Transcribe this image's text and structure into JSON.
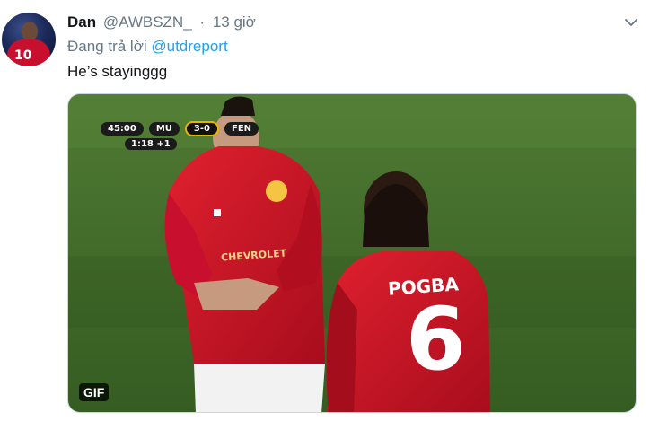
{
  "tweet": {
    "author_name": "Dan",
    "author_handle": "@AWBSZN_",
    "separator": "·",
    "time": "13 giờ",
    "reply_prefix": "Đang trả lời",
    "reply_mention": "@utdreport",
    "text": "He’s stayinggg",
    "avatar_number": "10"
  },
  "media": {
    "badge": "GIF",
    "scoreboard": {
      "time": "45:00",
      "home": "MU",
      "score": "3-0",
      "away": "FEN",
      "added_time": "1:18 +1"
    },
    "jersey_name": "POGBA",
    "jersey_number": "6",
    "sponsor": "CHEVROLET"
  },
  "icons": {
    "caret": "chevron-down-icon"
  },
  "colors": {
    "text": "#14171a",
    "muted": "#657786",
    "link": "#1da1f2",
    "jersey_red": "#c8102e",
    "pitch_green": "#3f6b2a"
  }
}
